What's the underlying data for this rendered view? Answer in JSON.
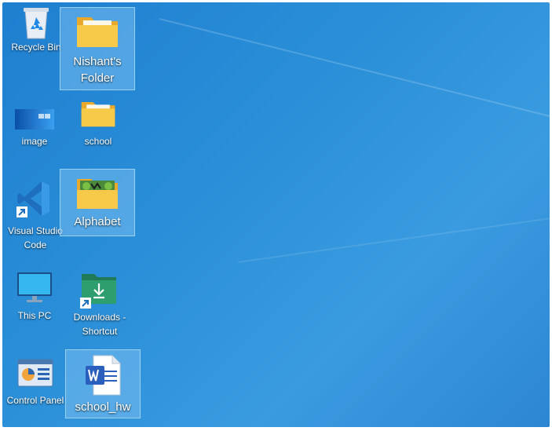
{
  "desktop": {
    "icons": [
      {
        "label": "Recycle Bin",
        "icon": "recycle-bin-icon"
      },
      {
        "label": "Nishant's Folder",
        "icon": "folder-icon",
        "selected": true
      },
      {
        "label": "image",
        "icon": "image-file-icon"
      },
      {
        "label": "school",
        "icon": "folder-icon"
      },
      {
        "label": "Visual Studio Code",
        "icon": "vscode-icon",
        "shortcut": true
      },
      {
        "label": "Alphabet",
        "icon": "folder-with-image-icon",
        "selected": true
      },
      {
        "label": "This PC",
        "icon": "monitor-icon"
      },
      {
        "label": "Downloads - Shortcut",
        "icon": "downloads-folder-icon",
        "shortcut": true
      },
      {
        "label": "Control Panel",
        "icon": "control-panel-icon"
      },
      {
        "label": "school_hw",
        "icon": "word-document-icon",
        "selected": true
      }
    ]
  },
  "colors": {
    "wallpaper": "#2a8fd8",
    "selection": "#78bef0",
    "folder_yellow": "#f7c948",
    "downloads_green": "#2e9e6e",
    "word_blue": "#2b5fbd"
  }
}
